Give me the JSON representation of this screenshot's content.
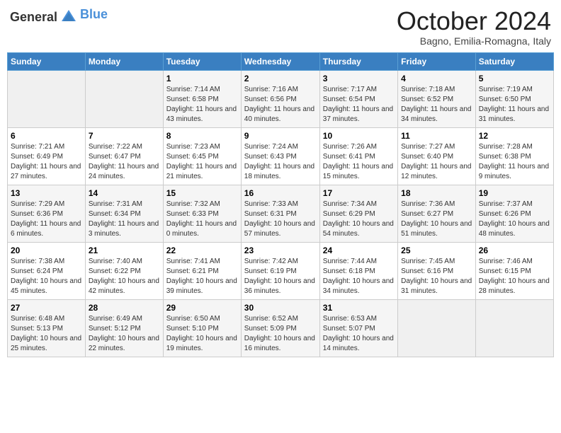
{
  "header": {
    "logo_general": "General",
    "logo_blue": "Blue",
    "month_title": "October 2024",
    "location": "Bagno, Emilia-Romagna, Italy"
  },
  "weekdays": [
    "Sunday",
    "Monday",
    "Tuesday",
    "Wednesday",
    "Thursday",
    "Friday",
    "Saturday"
  ],
  "weeks": [
    [
      {
        "day": "",
        "detail": ""
      },
      {
        "day": "",
        "detail": ""
      },
      {
        "day": "1",
        "detail": "Sunrise: 7:14 AM\nSunset: 6:58 PM\nDaylight: 11 hours and 43 minutes."
      },
      {
        "day": "2",
        "detail": "Sunrise: 7:16 AM\nSunset: 6:56 PM\nDaylight: 11 hours and 40 minutes."
      },
      {
        "day": "3",
        "detail": "Sunrise: 7:17 AM\nSunset: 6:54 PM\nDaylight: 11 hours and 37 minutes."
      },
      {
        "day": "4",
        "detail": "Sunrise: 7:18 AM\nSunset: 6:52 PM\nDaylight: 11 hours and 34 minutes."
      },
      {
        "day": "5",
        "detail": "Sunrise: 7:19 AM\nSunset: 6:50 PM\nDaylight: 11 hours and 31 minutes."
      }
    ],
    [
      {
        "day": "6",
        "detail": "Sunrise: 7:21 AM\nSunset: 6:49 PM\nDaylight: 11 hours and 27 minutes."
      },
      {
        "day": "7",
        "detail": "Sunrise: 7:22 AM\nSunset: 6:47 PM\nDaylight: 11 hours and 24 minutes."
      },
      {
        "day": "8",
        "detail": "Sunrise: 7:23 AM\nSunset: 6:45 PM\nDaylight: 11 hours and 21 minutes."
      },
      {
        "day": "9",
        "detail": "Sunrise: 7:24 AM\nSunset: 6:43 PM\nDaylight: 11 hours and 18 minutes."
      },
      {
        "day": "10",
        "detail": "Sunrise: 7:26 AM\nSunset: 6:41 PM\nDaylight: 11 hours and 15 minutes."
      },
      {
        "day": "11",
        "detail": "Sunrise: 7:27 AM\nSunset: 6:40 PM\nDaylight: 11 hours and 12 minutes."
      },
      {
        "day": "12",
        "detail": "Sunrise: 7:28 AM\nSunset: 6:38 PM\nDaylight: 11 hours and 9 minutes."
      }
    ],
    [
      {
        "day": "13",
        "detail": "Sunrise: 7:29 AM\nSunset: 6:36 PM\nDaylight: 11 hours and 6 minutes."
      },
      {
        "day": "14",
        "detail": "Sunrise: 7:31 AM\nSunset: 6:34 PM\nDaylight: 11 hours and 3 minutes."
      },
      {
        "day": "15",
        "detail": "Sunrise: 7:32 AM\nSunset: 6:33 PM\nDaylight: 11 hours and 0 minutes."
      },
      {
        "day": "16",
        "detail": "Sunrise: 7:33 AM\nSunset: 6:31 PM\nDaylight: 10 hours and 57 minutes."
      },
      {
        "day": "17",
        "detail": "Sunrise: 7:34 AM\nSunset: 6:29 PM\nDaylight: 10 hours and 54 minutes."
      },
      {
        "day": "18",
        "detail": "Sunrise: 7:36 AM\nSunset: 6:27 PM\nDaylight: 10 hours and 51 minutes."
      },
      {
        "day": "19",
        "detail": "Sunrise: 7:37 AM\nSunset: 6:26 PM\nDaylight: 10 hours and 48 minutes."
      }
    ],
    [
      {
        "day": "20",
        "detail": "Sunrise: 7:38 AM\nSunset: 6:24 PM\nDaylight: 10 hours and 45 minutes."
      },
      {
        "day": "21",
        "detail": "Sunrise: 7:40 AM\nSunset: 6:22 PM\nDaylight: 10 hours and 42 minutes."
      },
      {
        "day": "22",
        "detail": "Sunrise: 7:41 AM\nSunset: 6:21 PM\nDaylight: 10 hours and 39 minutes."
      },
      {
        "day": "23",
        "detail": "Sunrise: 7:42 AM\nSunset: 6:19 PM\nDaylight: 10 hours and 36 minutes."
      },
      {
        "day": "24",
        "detail": "Sunrise: 7:44 AM\nSunset: 6:18 PM\nDaylight: 10 hours and 34 minutes."
      },
      {
        "day": "25",
        "detail": "Sunrise: 7:45 AM\nSunset: 6:16 PM\nDaylight: 10 hours and 31 minutes."
      },
      {
        "day": "26",
        "detail": "Sunrise: 7:46 AM\nSunset: 6:15 PM\nDaylight: 10 hours and 28 minutes."
      }
    ],
    [
      {
        "day": "27",
        "detail": "Sunrise: 6:48 AM\nSunset: 5:13 PM\nDaylight: 10 hours and 25 minutes."
      },
      {
        "day": "28",
        "detail": "Sunrise: 6:49 AM\nSunset: 5:12 PM\nDaylight: 10 hours and 22 minutes."
      },
      {
        "day": "29",
        "detail": "Sunrise: 6:50 AM\nSunset: 5:10 PM\nDaylight: 10 hours and 19 minutes."
      },
      {
        "day": "30",
        "detail": "Sunrise: 6:52 AM\nSunset: 5:09 PM\nDaylight: 10 hours and 16 minutes."
      },
      {
        "day": "31",
        "detail": "Sunrise: 6:53 AM\nSunset: 5:07 PM\nDaylight: 10 hours and 14 minutes."
      },
      {
        "day": "",
        "detail": ""
      },
      {
        "day": "",
        "detail": ""
      }
    ]
  ]
}
